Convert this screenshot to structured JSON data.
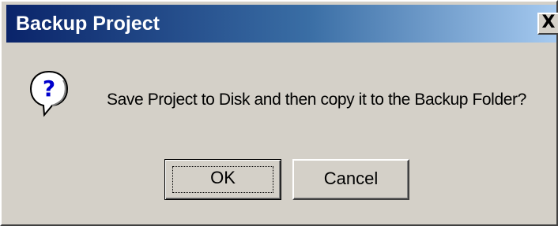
{
  "dialog": {
    "title": "Backup Project",
    "close_label": "X",
    "icon": "question-icon",
    "message": "Save Project to Disk and then copy it to the Backup Folder?"
  },
  "buttons": {
    "ok_label": "OK",
    "cancel_label": "Cancel"
  },
  "colors": {
    "title_bar_start": "#0a246a",
    "title_bar_end": "#a6caf0",
    "dialog_face": "#d4d0c8",
    "icon_accent": "#0000cc"
  }
}
